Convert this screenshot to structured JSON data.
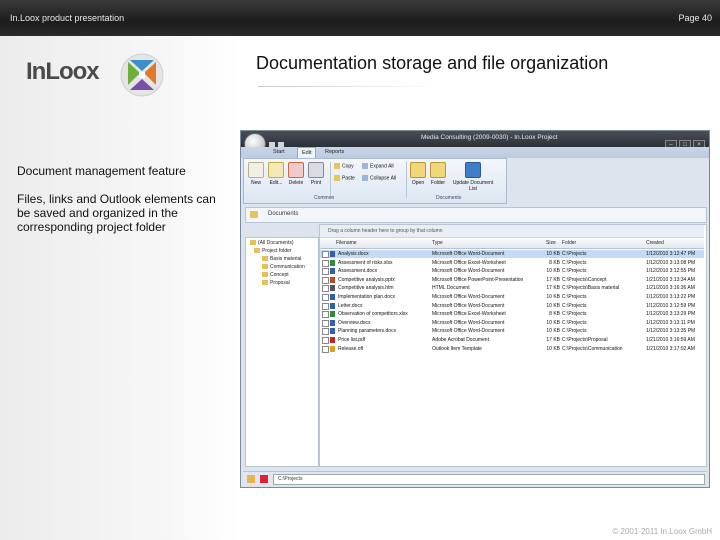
{
  "header": {
    "left": "In.Loox product presentation",
    "right": "Page 40"
  },
  "logo": {
    "text": "InLoox"
  },
  "slide": {
    "title": "Documentation storage and file organization",
    "feature": "Document management feature",
    "description": "Files, links and Outlook elements can be saved and organized in the corresponding project folder",
    "footer": "© 2001-2011 In.Loox GmbH"
  },
  "app": {
    "window_title": "Media Consulting (2009-0030) - In.Loox Project",
    "tabs": [
      "Start",
      "Edit",
      "Reports"
    ],
    "active_tab": "Edit",
    "ribbon": {
      "buttons": [
        "New",
        "Edit...",
        "Delete",
        "Print"
      ],
      "small": [
        "Copy",
        "Paste",
        "Expand All",
        "Collapse All"
      ],
      "doc_buttons": [
        "Open",
        "Folder",
        "Update Document List"
      ],
      "groups": [
        "Common",
        "Documents"
      ]
    },
    "docbar_label": "Documents",
    "group_hint": "Drag a column header here to group by that column",
    "tree": [
      "(All Documents)",
      "Project folder",
      "Basis material",
      "Communication",
      "Concept",
      "Proposal"
    ],
    "columns": [
      "Filename",
      "Type",
      "Size",
      "Folder",
      "Created"
    ],
    "rows": [
      {
        "name": "Analysis.docx",
        "type": "Microsoft Office Word-Document",
        "size": "10 KB",
        "folder": "C:\\Projects",
        "created": "1/12/2010 3:12:47 PM"
      },
      {
        "name": "Assessment of risks.xlsx",
        "type": "Microsoft Office Excel-Worksheet",
        "size": "8 KB",
        "folder": "C:\\Projects",
        "created": "1/12/2010 3:13:08 PM"
      },
      {
        "name": "Assessment.docx",
        "type": "Microsoft Office Word-Document",
        "size": "10 KB",
        "folder": "C:\\Projects",
        "created": "1/12/2010 3:12:55 PM"
      },
      {
        "name": "Competitive analysis.pptx",
        "type": "Microsoft Office PowerPoint-Presentation",
        "size": "17 KB",
        "folder": "C:\\Projects\\Concept",
        "created": "1/21/2010 3:13:34 AM"
      },
      {
        "name": "Competitive analysis.htm",
        "type": "HTML Document",
        "size": "17 KB",
        "folder": "C:\\Projects\\Basis material",
        "created": "1/21/2010 3:16:36 AM"
      },
      {
        "name": "Implementation plan.docx",
        "type": "Microsoft Office Word-Document",
        "size": "10 KB",
        "folder": "C:\\Projects",
        "created": "1/12/2010 3:13:22 PM"
      },
      {
        "name": "Letter.docx",
        "type": "Microsoft Office Word-Document",
        "size": "10 KB",
        "folder": "C:\\Projects",
        "created": "1/12/2010 3:12:59 PM"
      },
      {
        "name": "Observation of competitors.xlsx",
        "type": "Microsoft Office Excel-Worksheet",
        "size": "8 KB",
        "folder": "C:\\Projects",
        "created": "1/12/2010 3:13:29 PM"
      },
      {
        "name": "Overview.docx",
        "type": "Microsoft Office Word-Document",
        "size": "10 KB",
        "folder": "C:\\Projects",
        "created": "1/12/2010 3:13:11 PM"
      },
      {
        "name": "Planning parameters.docx",
        "type": "Microsoft Office Word-Document",
        "size": "10 KB",
        "folder": "C:\\Projects",
        "created": "1/12/2010 3:13:35 PM"
      },
      {
        "name": "Price list.pdf",
        "type": "Adobe Acrobat Document",
        "size": "17 KB",
        "folder": "C:\\Projects\\Proposal",
        "created": "1/21/2010 3:16:59 AM"
      },
      {
        "name": "Release.oft",
        "type": "Outlook Item Template",
        "size": "10 KB",
        "folder": "C:\\Projects\\Communication",
        "created": "1/21/2010 3:17:02 AM"
      }
    ],
    "status_path": "C:\\Projects"
  }
}
